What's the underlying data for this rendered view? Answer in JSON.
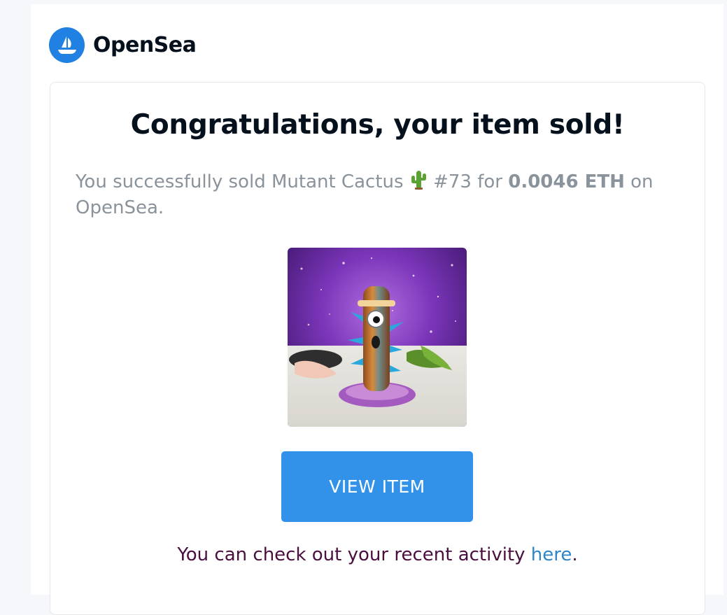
{
  "brand": {
    "name": "OpenSea",
    "logo_icon": "opensea-ship-icon",
    "logo_color": "#2081e2"
  },
  "email": {
    "title": "Congratulations, your item sold!",
    "message": {
      "prefix": "You successfully sold Mutant Cactus",
      "emoji": "cactus-emoji",
      "item_number": "#73 for",
      "price": "0.0046 ETH",
      "suffix": "on OpenSea."
    },
    "item_image": "mutant-cactus-nft-image",
    "button": {
      "label": "VIEW ITEM",
      "color": "#3291e9"
    },
    "activity": {
      "text": "You can check out your recent activity",
      "link_label": "here",
      "end": "."
    }
  }
}
